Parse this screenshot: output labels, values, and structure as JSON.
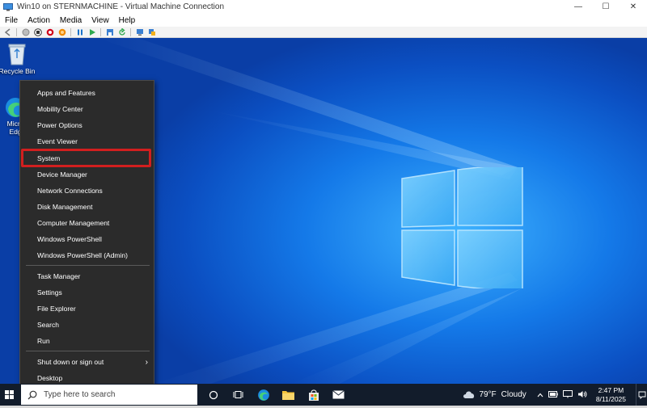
{
  "window": {
    "title": "Win10 on STERNMACHINE - Virtual Machine Connection",
    "minimize_glyph": "—",
    "maximize_glyph": "☐",
    "close_glyph": "✕"
  },
  "menubar": {
    "items": [
      "File",
      "Action",
      "Media",
      "View",
      "Help"
    ]
  },
  "toolbar": {
    "icons": [
      "back-icon",
      "ctrl-alt-del-icon",
      "stop-icon",
      "shutdown-icon",
      "power-icon",
      "pause-icon",
      "start-icon",
      "save-icon",
      "revert-icon",
      "checkpoint-icon",
      "enhanced-session-icon"
    ]
  },
  "desktop": {
    "icons": [
      {
        "name": "Recycle Bin"
      },
      {
        "name": "Microsoft Edge",
        "label_visible": "Micro Edg"
      }
    ]
  },
  "context_menu": {
    "highlighted_item": "System",
    "highlight_color": "#d21f1f",
    "groups": [
      [
        "Apps and Features",
        "Mobility Center",
        "Power Options",
        "Event Viewer",
        "System",
        "Device Manager",
        "Network Connections",
        "Disk Management",
        "Computer Management",
        "Windows PowerShell",
        "Windows PowerShell (Admin)"
      ],
      [
        "Task Manager",
        "Settings",
        "File Explorer",
        "Search",
        "Run"
      ],
      [
        "Shut down or sign out",
        "Desktop"
      ]
    ],
    "submenu_chevron": "›"
  },
  "taskbar": {
    "search_placeholder": "Type here to search",
    "weather": {
      "temp": "79°F",
      "condition": "Cloudy"
    },
    "clock": {
      "time": "2:47 PM",
      "date": "8/11/2025"
    },
    "tray_icons": [
      "chevron-up-icon",
      "battery-icon",
      "network-icon",
      "volume-icon"
    ],
    "pinned_icons": [
      "task-view-icon",
      "widgets-icon",
      "edge-icon",
      "file-explorer-icon",
      "store-icon",
      "mail-icon"
    ]
  },
  "colors": {
    "menu_bg": "#2b2b2b",
    "taskbar_bg": "#121c2b",
    "desktop_blue": "#1479e8"
  }
}
